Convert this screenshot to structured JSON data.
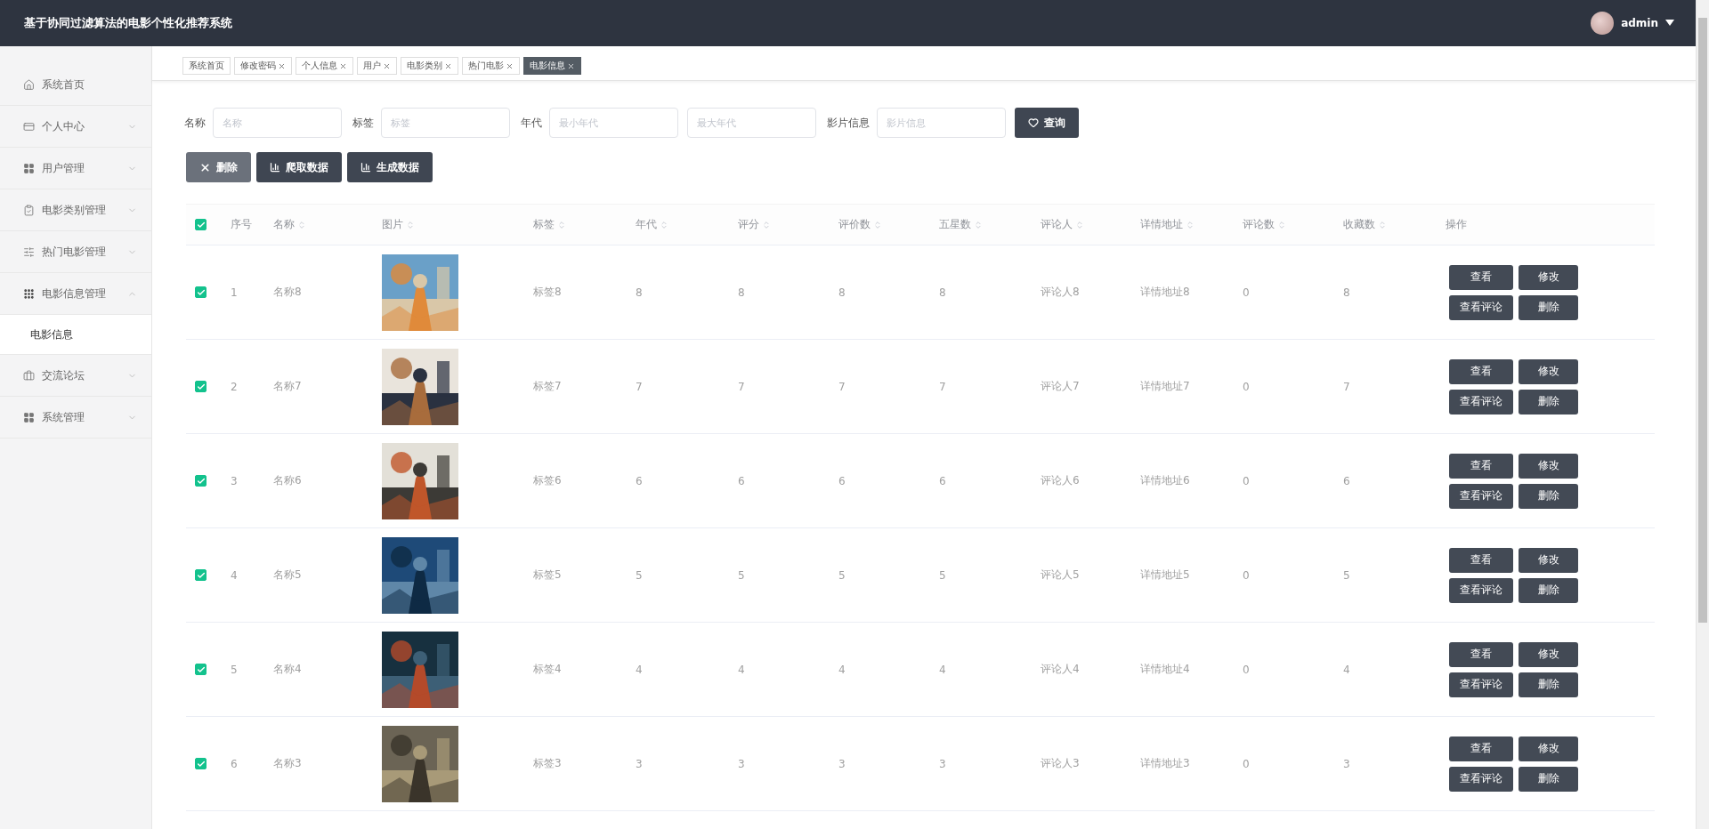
{
  "header": {
    "title": "基于协同过滤算法的电影个性化推荐系统",
    "user": "admin"
  },
  "sidebar": {
    "items": [
      {
        "label": "系统首页",
        "kind": "link"
      },
      {
        "label": "个人中心",
        "kind": "menu",
        "expanded": false
      },
      {
        "label": "用户管理",
        "kind": "menu",
        "expanded": false
      },
      {
        "label": "电影类别管理",
        "kind": "menu",
        "expanded": false
      },
      {
        "label": "热门电影管理",
        "kind": "menu",
        "expanded": false
      },
      {
        "label": "电影信息管理",
        "kind": "menu",
        "expanded": true,
        "children": [
          {
            "label": "电影信息",
            "selected": true
          }
        ]
      },
      {
        "label": "交流论坛",
        "kind": "menu",
        "expanded": false
      },
      {
        "label": "系统管理",
        "kind": "menu",
        "expanded": false
      }
    ]
  },
  "tabs": [
    {
      "label": "系统首页",
      "closable": false,
      "selected": false
    },
    {
      "label": "修改密码",
      "closable": true,
      "selected": false
    },
    {
      "label": "个人信息",
      "closable": true,
      "selected": false
    },
    {
      "label": "用户",
      "closable": true,
      "selected": false
    },
    {
      "label": "电影类别",
      "closable": true,
      "selected": false
    },
    {
      "label": "热门电影",
      "closable": true,
      "selected": false
    },
    {
      "label": "电影信息",
      "closable": true,
      "selected": true
    }
  ],
  "filters": [
    {
      "label": "名称",
      "fields": [
        {
          "placeholder": "名称"
        }
      ]
    },
    {
      "label": "标签",
      "fields": [
        {
          "placeholder": "标签"
        }
      ]
    },
    {
      "label": "年代",
      "fields": [
        {
          "placeholder": "最小年代"
        },
        {
          "placeholder": "最大年代"
        }
      ]
    },
    {
      "label": "影片信息",
      "fields": [
        {
          "placeholder": "影片信息"
        }
      ]
    }
  ],
  "search_button": {
    "label": "查询"
  },
  "toolbar": [
    {
      "label": "删除",
      "highlighted": true
    },
    {
      "label": "爬取数据",
      "highlighted": false
    },
    {
      "label": "生成数据",
      "highlighted": false
    }
  ],
  "table": {
    "all_checked": true,
    "columns": [
      {
        "label": "序号",
        "sortable": false
      },
      {
        "label": "名称",
        "sortable": true
      },
      {
        "label": "图片",
        "sortable": true
      },
      {
        "label": "标签",
        "sortable": true
      },
      {
        "label": "年代",
        "sortable": true
      },
      {
        "label": "评分",
        "sortable": true
      },
      {
        "label": "评价数",
        "sortable": true
      },
      {
        "label": "五星数",
        "sortable": true
      },
      {
        "label": "评论人",
        "sortable": true
      },
      {
        "label": "详情地址",
        "sortable": true
      },
      {
        "label": "评论数",
        "sortable": true
      },
      {
        "label": "收藏数",
        "sortable": true
      },
      {
        "label": "操作",
        "sortable": false
      }
    ],
    "rows": [
      {
        "checked": true,
        "cells": [
          "1",
          "名称8",
          {
            "kind": "picture"
          },
          "标签8",
          "8",
          "8",
          "8",
          "8",
          "评论人8",
          "详情地址8",
          "0",
          "8"
        ],
        "actions": [
          "查看",
          "修改",
          "查看评论",
          "删除"
        ]
      },
      {
        "checked": true,
        "cells": [
          "2",
          "名称7",
          {
            "kind": "picture"
          },
          "标签7",
          "7",
          "7",
          "7",
          "7",
          "评论人7",
          "详情地址7",
          "0",
          "7"
        ],
        "actions": [
          "查看",
          "修改",
          "查看评论",
          "删除"
        ]
      },
      {
        "checked": true,
        "cells": [
          "3",
          "名称6",
          {
            "kind": "picture"
          },
          "标签6",
          "6",
          "6",
          "6",
          "6",
          "评论人6",
          "详情地址6",
          "0",
          "6"
        ],
        "actions": [
          "查看",
          "修改",
          "查看评论",
          "删除"
        ]
      },
      {
        "checked": true,
        "cells": [
          "4",
          "名称5",
          {
            "kind": "picture"
          },
          "标签5",
          "5",
          "5",
          "5",
          "5",
          "评论人5",
          "详情地址5",
          "0",
          "5"
        ],
        "actions": [
          "查看",
          "修改",
          "查看评论",
          "删除"
        ]
      },
      {
        "checked": true,
        "cells": [
          "5",
          "名称4",
          {
            "kind": "picture"
          },
          "标签4",
          "4",
          "4",
          "4",
          "4",
          "评论人4",
          "详情地址4",
          "0",
          "4"
        ],
        "actions": [
          "查看",
          "修改",
          "查看评论",
          "删除"
        ]
      },
      {
        "checked": true,
        "cells": [
          "6",
          "名称3",
          {
            "kind": "picture"
          },
          "标签3",
          "3",
          "3",
          "3",
          "3",
          "评论人3",
          "详情地址3",
          "0",
          "3"
        ],
        "actions": [
          "查看",
          "修改",
          "查看评论",
          "删除"
        ]
      }
    ]
  }
}
